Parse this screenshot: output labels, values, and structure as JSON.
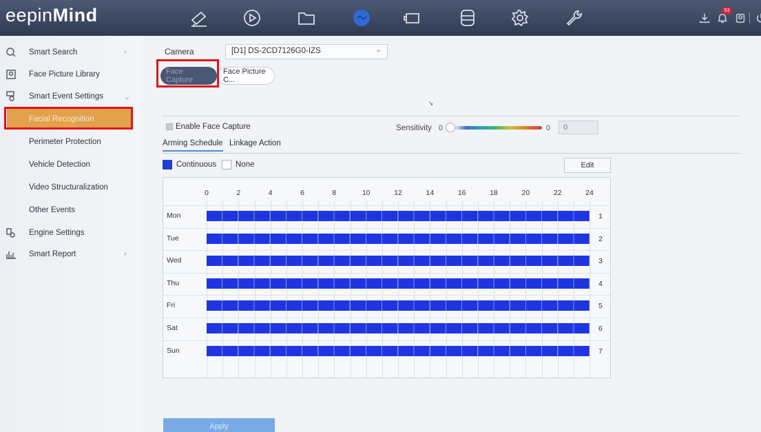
{
  "app": {
    "logo_prefix": "eepin",
    "logo_bold": "Mind",
    "alarm_count": "53"
  },
  "topnav": {
    "icons": [
      "camera-icon",
      "playback-icon",
      "folder-icon",
      "smart-analysis-icon",
      "monitor-icon",
      "storage-icon",
      "settings-icon",
      "maintenance-icon"
    ],
    "active": "smart-analysis-icon"
  },
  "sidebar": {
    "items": [
      {
        "label": "Smart Search",
        "icon": "smart-search-icon",
        "arrow": "›"
      },
      {
        "label": "Face Picture Library",
        "icon": "face-library-icon",
        "arrow": ""
      },
      {
        "label": "Smart Event Settings",
        "icon": "event-settings-icon",
        "arrow": "⌄"
      },
      {
        "label": "Facial Recognition",
        "icon": "",
        "arrow": ""
      },
      {
        "label": "Perimeter Protection",
        "icon": "",
        "arrow": ""
      },
      {
        "label": "Vehicle Detection",
        "icon": "",
        "arrow": ""
      },
      {
        "label": "Video Structuralization",
        "icon": "",
        "arrow": ""
      },
      {
        "label": "Other Events",
        "icon": "",
        "arrow": ""
      },
      {
        "label": "Engine Settings",
        "icon": "engine-settings-icon",
        "arrow": ""
      },
      {
        "label": "Smart Report",
        "icon": "smart-report-icon",
        "arrow": "›"
      }
    ],
    "active_index": 3
  },
  "main": {
    "camera_label": "Camera",
    "camera_value": "[D1] DS-2CD7126G0-IZS",
    "subtabs": [
      "Face Capture",
      "Face Picture C..."
    ],
    "enable_label": "Enable Face Capture",
    "sensitivity_label": "Sensitivity",
    "sensitivity_min": "0",
    "sensitivity_max": "0",
    "sensitivity_value": "0",
    "tabs": [
      "Arming Schedule",
      "Linkage Action"
    ],
    "legend_continuous": "Continuous",
    "legend_none": "None",
    "edit_label": "Edit",
    "apply_label": "Apply",
    "schedule": {
      "hours": [
        "0",
        "2",
        "4",
        "6",
        "8",
        "10",
        "12",
        "14",
        "16",
        "18",
        "20",
        "22",
        "24"
      ],
      "days": [
        "Mon",
        "Tue",
        "Wed",
        "Thu",
        "Fri",
        "Sat",
        "Sun"
      ],
      "row_numbers": [
        "1",
        "2",
        "3",
        "4",
        "5",
        "6",
        "7"
      ],
      "coverage": "00:00-24:00 Continuous"
    }
  },
  "colors": {
    "continuous": "#1f35e0",
    "highlight": "#e2121b",
    "active_menu": "#e1a24b"
  }
}
